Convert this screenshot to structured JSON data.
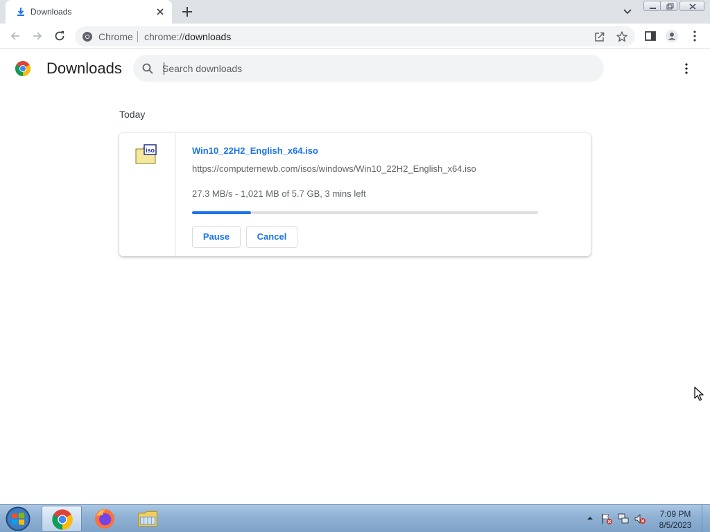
{
  "browser": {
    "tab": {
      "title": "Downloads"
    },
    "omnibox": {
      "chip": "Chrome",
      "url_scheme": "chrome://",
      "url_host": "downloads"
    }
  },
  "page": {
    "title": "Downloads",
    "search": {
      "placeholder": "Search downloads",
      "value": ""
    }
  },
  "downloads": {
    "date_group": "Today",
    "item": {
      "file_name": "Win10_22H2_English_x64.iso",
      "icon_label": "iso",
      "url": "https://computernewb.com/isos/windows/Win10_22H2_English_x64.iso",
      "status": "27.3 MB/s - 1,021 MB of 5.7 GB, 3 mins left",
      "progress_fraction": 0.17,
      "pause_label": "Pause",
      "cancel_label": "Cancel"
    }
  },
  "taskbar": {
    "clock_time": "7:09 PM",
    "clock_date": "8/5/2023",
    "pinned": [
      "chrome-icon",
      "firefox-icon",
      "file-explorer-icon"
    ]
  },
  "colors": {
    "accent": "#1a73e8",
    "tabstrip": "#dee1e6",
    "omnibox": "#f1f3f4"
  }
}
